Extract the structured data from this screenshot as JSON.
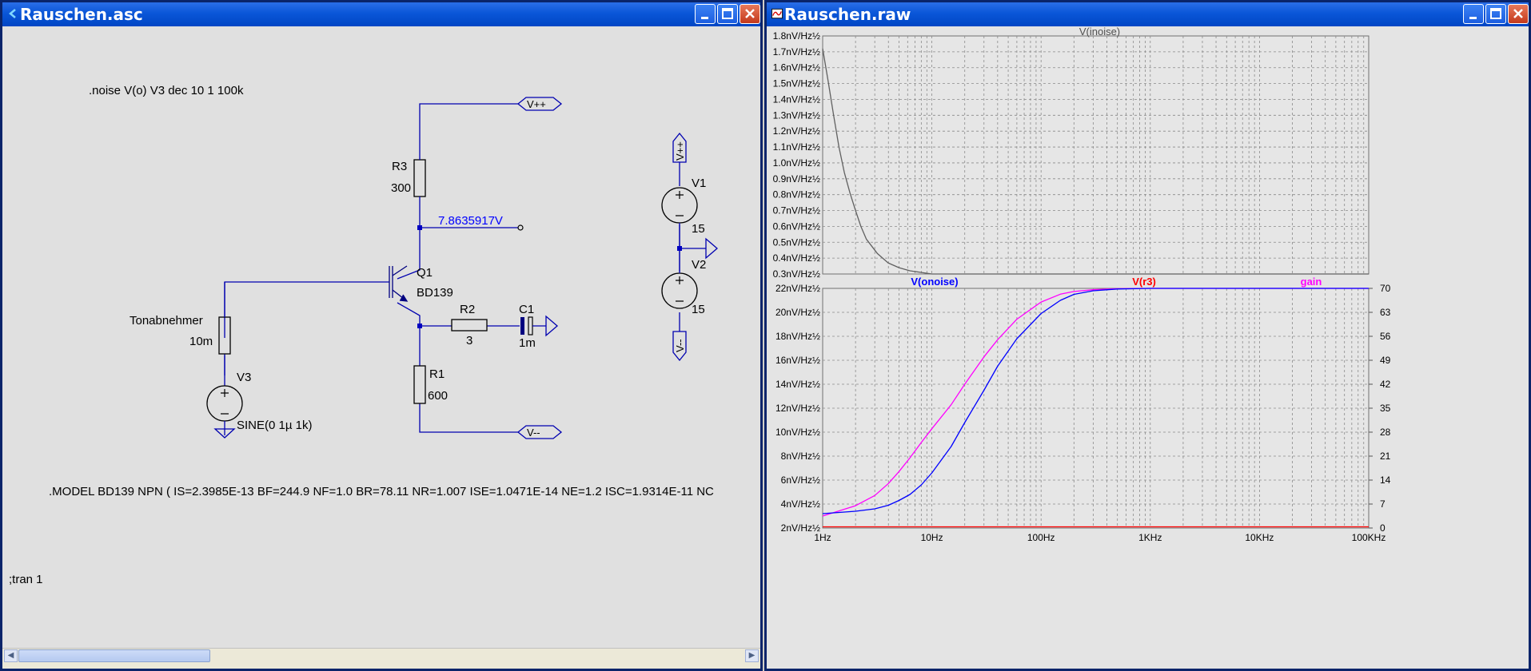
{
  "schematic_window": {
    "title": "Rauschen.asc",
    "directives": {
      "noise": ".noise V(o) V3 dec 10 1 100k",
      "model": ".MODEL BD139 NPN ( IS=2.3985E-13 BF=244.9 NF=1.0 BR=78.11 NR=1.007 ISE=1.0471E-14 NE=1.2 ISC=1.9314E-11 NC",
      "tran": ";tran 1"
    },
    "components": {
      "r3_name": "R3",
      "r3_value": "300",
      "q1_name": "Q1",
      "q1_model": "BD139",
      "r2_name": "R2",
      "r2_value": "3",
      "c1_name": "C1",
      "c1_value": "1m",
      "r1_name": "R1",
      "r1_value": "600",
      "tonabnehmer_name": "Tonabnehmer",
      "tonabnehmer_value": "10m",
      "v3_name": "V3",
      "v3_value": "SINE(0 1µ 1k)",
      "v1_name": "V1",
      "v1_value": "15",
      "v2_name": "V2",
      "v2_value": "15"
    },
    "nets": {
      "vpp": "V++",
      "vmm": "V--",
      "vpp_vertical": "V++",
      "vm_vertical": "V--"
    },
    "probe_voltage": "7.8635917V",
    "colors": {
      "wire": "#0000b0",
      "label": "#000000",
      "probe_text": "#0000ff",
      "background": "#e0e0e0"
    }
  },
  "plot_window": {
    "title": "Rauschen.raw",
    "top_pane": {
      "trace_label": "V(inoise)",
      "y_ticks": [
        "1.8nV/Hz½",
        "1.7nV/Hz½",
        "1.6nV/Hz½",
        "1.5nV/Hz½",
        "1.4nV/Hz½",
        "1.3nV/Hz½",
        "1.2nV/Hz½",
        "1.1nV/Hz½",
        "1.0nV/Hz½",
        "0.9nV/Hz½",
        "0.8nV/Hz½",
        "0.7nV/Hz½",
        "0.6nV/Hz½",
        "0.5nV/Hz½",
        "0.4nV/Hz½",
        "0.3nV/Hz½"
      ]
    },
    "bottom_pane": {
      "trace_labels": [
        "V(onoise)",
        "V(r3)",
        "gain"
      ],
      "y_ticks_left": [
        "22nV/Hz½",
        "20nV/Hz½",
        "18nV/Hz½",
        "16nV/Hz½",
        "14nV/Hz½",
        "12nV/Hz½",
        "10nV/Hz½",
        "8nV/Hz½",
        "6nV/Hz½",
        "4nV/Hz½",
        "2nV/Hz½"
      ],
      "y_ticks_right": [
        "70",
        "63",
        "56",
        "49",
        "42",
        "35",
        "28",
        "21",
        "14",
        "7",
        "0"
      ]
    },
    "x_ticks": [
      "1Hz",
      "10Hz",
      "100Hz",
      "1KHz",
      "10KHz",
      "100KHz"
    ],
    "colors": {
      "grid": "#808080",
      "plot_bg": "#e6e6e6",
      "onoise": "#0000ff",
      "r3": "#ff0000",
      "gain": "#ff00ff",
      "inoise": "#606060"
    }
  },
  "chart_data": [
    {
      "type": "line",
      "title": "V(inoise)",
      "xscale": "log",
      "xlim_hz": [
        1,
        100000
      ],
      "ylim": [
        0.3,
        1.8
      ],
      "yunit": "nV/Hz½",
      "grid": true,
      "series": [
        {
          "name": "V(inoise)",
          "x": [
            1,
            1.12,
            1.26,
            1.41,
            1.58,
            1.78,
            2,
            2.24,
            2.51,
            3.16,
            3.98,
            5,
            6.3,
            7.94,
            10,
            15.8,
            100000
          ],
          "y": [
            1.72,
            1.52,
            1.3,
            1.1,
            0.94,
            0.81,
            0.7,
            0.6,
            0.52,
            0.43,
            0.37,
            0.34,
            0.32,
            0.31,
            0.3,
            0.3,
            0.3
          ]
        }
      ]
    },
    {
      "type": "line",
      "xscale": "log",
      "xlim_hz": [
        1,
        100000
      ],
      "ylim_left": [
        2,
        22
      ],
      "ylim_right": [
        0,
        70
      ],
      "yunit_left": "nV/Hz½",
      "grid": true,
      "series": [
        {
          "name": "V(onoise)",
          "axis": "left",
          "x": [
            1,
            2,
            3,
            4,
            5,
            6.3,
            8,
            10,
            15,
            20,
            30,
            40,
            60,
            100,
            150,
            200,
            300,
            500,
            1000,
            100000
          ],
          "y": [
            3.2,
            3.4,
            3.6,
            3.9,
            4.3,
            4.8,
            5.6,
            6.6,
            8.8,
            10.8,
            13.5,
            15.5,
            17.8,
            19.9,
            21.0,
            21.5,
            21.8,
            21.95,
            22.0,
            22.0
          ]
        },
        {
          "name": "V(r3)",
          "axis": "left",
          "x": [
            1,
            100000
          ],
          "y": [
            2.1,
            2.1
          ]
        },
        {
          "name": "gain",
          "axis": "right",
          "x": [
            1,
            2,
            3,
            4,
            5,
            6.3,
            8,
            10,
            15,
            20,
            30,
            40,
            60,
            100,
            150,
            200,
            300,
            500,
            1000,
            100000
          ],
          "y": [
            3.5,
            6.5,
            9.5,
            13,
            16.5,
            20.5,
            25,
            29,
            36,
            42,
            50,
            55,
            61,
            66,
            68.3,
            69.1,
            69.6,
            69.9,
            70,
            70
          ]
        }
      ]
    }
  ]
}
